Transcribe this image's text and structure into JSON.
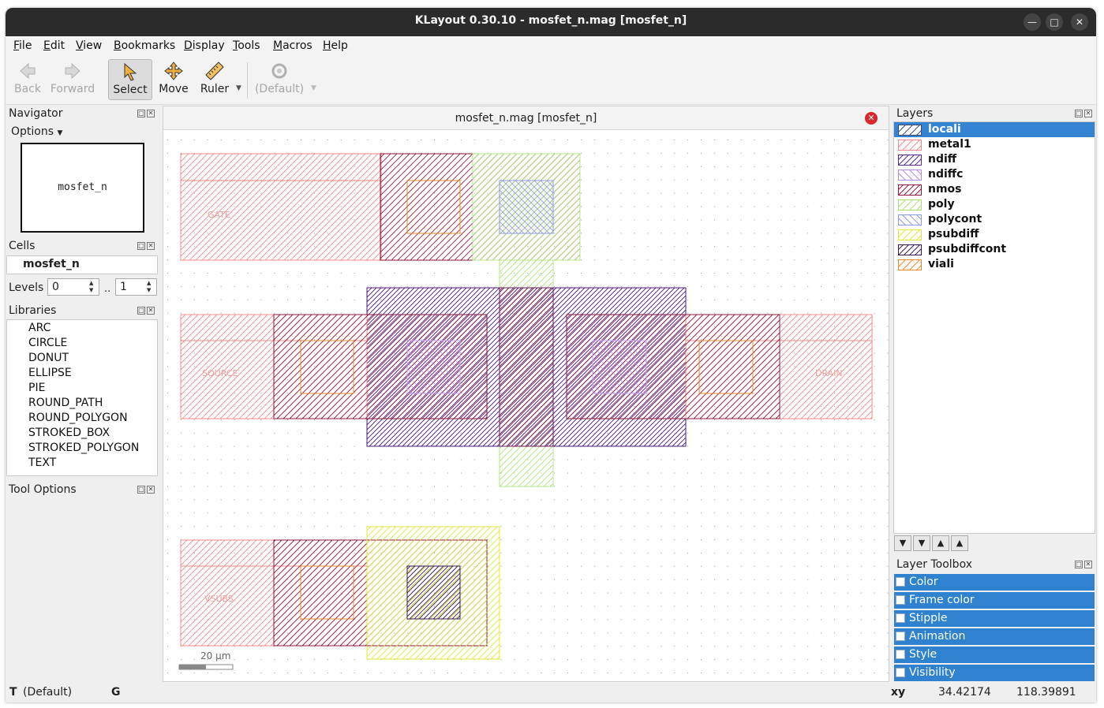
{
  "window": {
    "title": "KLayout 0.30.10 - mosfet_n.mag [mosfet_n]"
  },
  "menubar": [
    "File",
    "Edit",
    "View",
    "Bookmarks",
    "Display",
    "Tools",
    "Macros",
    "Help"
  ],
  "toolbar": {
    "back": "Back",
    "forward": "Forward",
    "select": "Select",
    "move": "Move",
    "ruler": "Ruler",
    "default": "(Default)"
  },
  "navigator": {
    "title": "Navigator",
    "options": "Options",
    "cell_preview": "mosfet_n"
  },
  "cells": {
    "title": "Cells",
    "items": [
      "mosfet_n"
    ],
    "levels_label": "Levels",
    "level_from": "0",
    "level_sep": "..",
    "level_to": "1"
  },
  "libraries": {
    "title": "Libraries",
    "items": [
      "ARC",
      "CIRCLE",
      "DONUT",
      "ELLIPSE",
      "PIE",
      "ROUND_PATH",
      "ROUND_POLYGON",
      "STROKED_BOX",
      "STROKED_POLYGON",
      "TEXT"
    ]
  },
  "tool_options": {
    "title": "Tool Options"
  },
  "canvas": {
    "tab": "mosfet_n.mag [mosfet_n]",
    "labels": {
      "gate": "GATE",
      "source": "SOURCE",
      "drain": "DRAIN",
      "vsubs": "VSUBS"
    },
    "scale": "20 µm"
  },
  "layers": {
    "title": "Layers",
    "items": [
      {
        "name": "locali",
        "color": "#4a5a8c",
        "selected": true
      },
      {
        "name": "metal1",
        "color": "#f08a8a",
        "selected": false
      },
      {
        "name": "ndiff",
        "color": "#5a2a8a",
        "selected": false
      },
      {
        "name": "ndiffc",
        "color": "#b48be0",
        "selected": false
      },
      {
        "name": "nmos",
        "color": "#8a1a3a",
        "selected": false
      },
      {
        "name": "poly",
        "color": "#a8e07a",
        "selected": false
      },
      {
        "name": "polycont",
        "color": "#8a9ae8",
        "selected": false
      },
      {
        "name": "psubdiff",
        "color": "#e8f04a",
        "selected": false
      },
      {
        "name": "psubdiffcont",
        "color": "#3a1a5a",
        "selected": false
      },
      {
        "name": "viali",
        "color": "#e88a2a",
        "selected": false
      }
    ]
  },
  "layer_toolbox": {
    "title": "Layer Toolbox",
    "items": [
      "Color",
      "Frame color",
      "Stipple",
      "Animation",
      "Style",
      "Visibility"
    ]
  },
  "status": {
    "tool": "T",
    "default": "(Default)",
    "grid": "G",
    "xy_label": "xy",
    "x": "34.42174",
    "y": "118.39891"
  }
}
